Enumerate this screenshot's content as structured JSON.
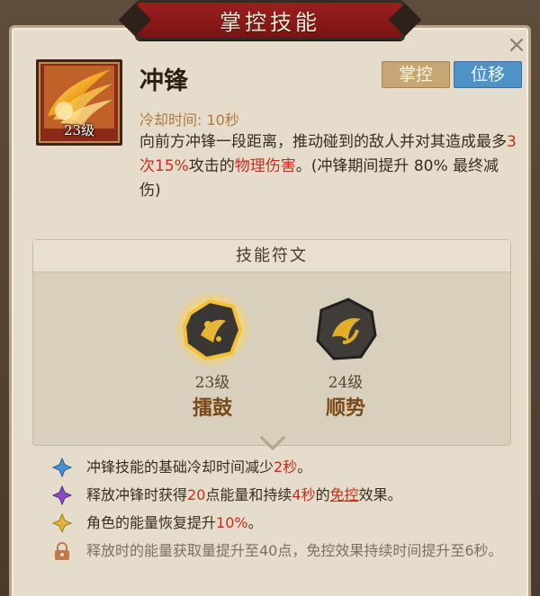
{
  "header": {
    "title": "掌控技能"
  },
  "skill": {
    "name": "冲锋",
    "level": "23级",
    "tags": [
      "掌控",
      "位移"
    ],
    "cooldown": "冷却时间: 10秒",
    "description": {
      "p1": "向前方冲锋一段距离，推动碰到的敌人并对其造成最多",
      "count": "3次",
      "pct": "15%",
      "p2": "攻击的",
      "dmg": "物理伤害",
      "p3": "。(冲锋期间提升 80% 最终减伤)"
    }
  },
  "runes": {
    "title": "技能符文",
    "items": [
      {
        "level": "23级",
        "name": "擂鼓",
        "selected": true
      },
      {
        "level": "24级",
        "name": "顺势",
        "selected": false
      }
    ]
  },
  "effects": [
    {
      "icon": "blue-diamond-icon",
      "color": "#4b8fd6",
      "parts": [
        "冲锋技能的基础冷却时间减少",
        "2秒",
        "。"
      ]
    },
    {
      "icon": "purple-diamond-icon",
      "color": "#8a4cc4",
      "parts": [
        "释放冲锋时获得",
        "20",
        "点能量和持续",
        "4秒",
        "的",
        "免控",
        "效果。"
      ]
    },
    {
      "icon": "gold-diamond-icon",
      "color": "#e1b53a",
      "parts": [
        "角色的能量恢复提升",
        "10%",
        "。"
      ]
    },
    {
      "icon": "lock-icon",
      "color": "#c07a4a",
      "locked_text": "释放时的能量获取量提升至40点，免控效果持续时间提升至6秒。"
    }
  ],
  "colors": {
    "accent_red": "#c22f1d",
    "banner": "#8c1b1b",
    "tag_move": "#4f92c8",
    "tag_control": "#c6a774"
  }
}
